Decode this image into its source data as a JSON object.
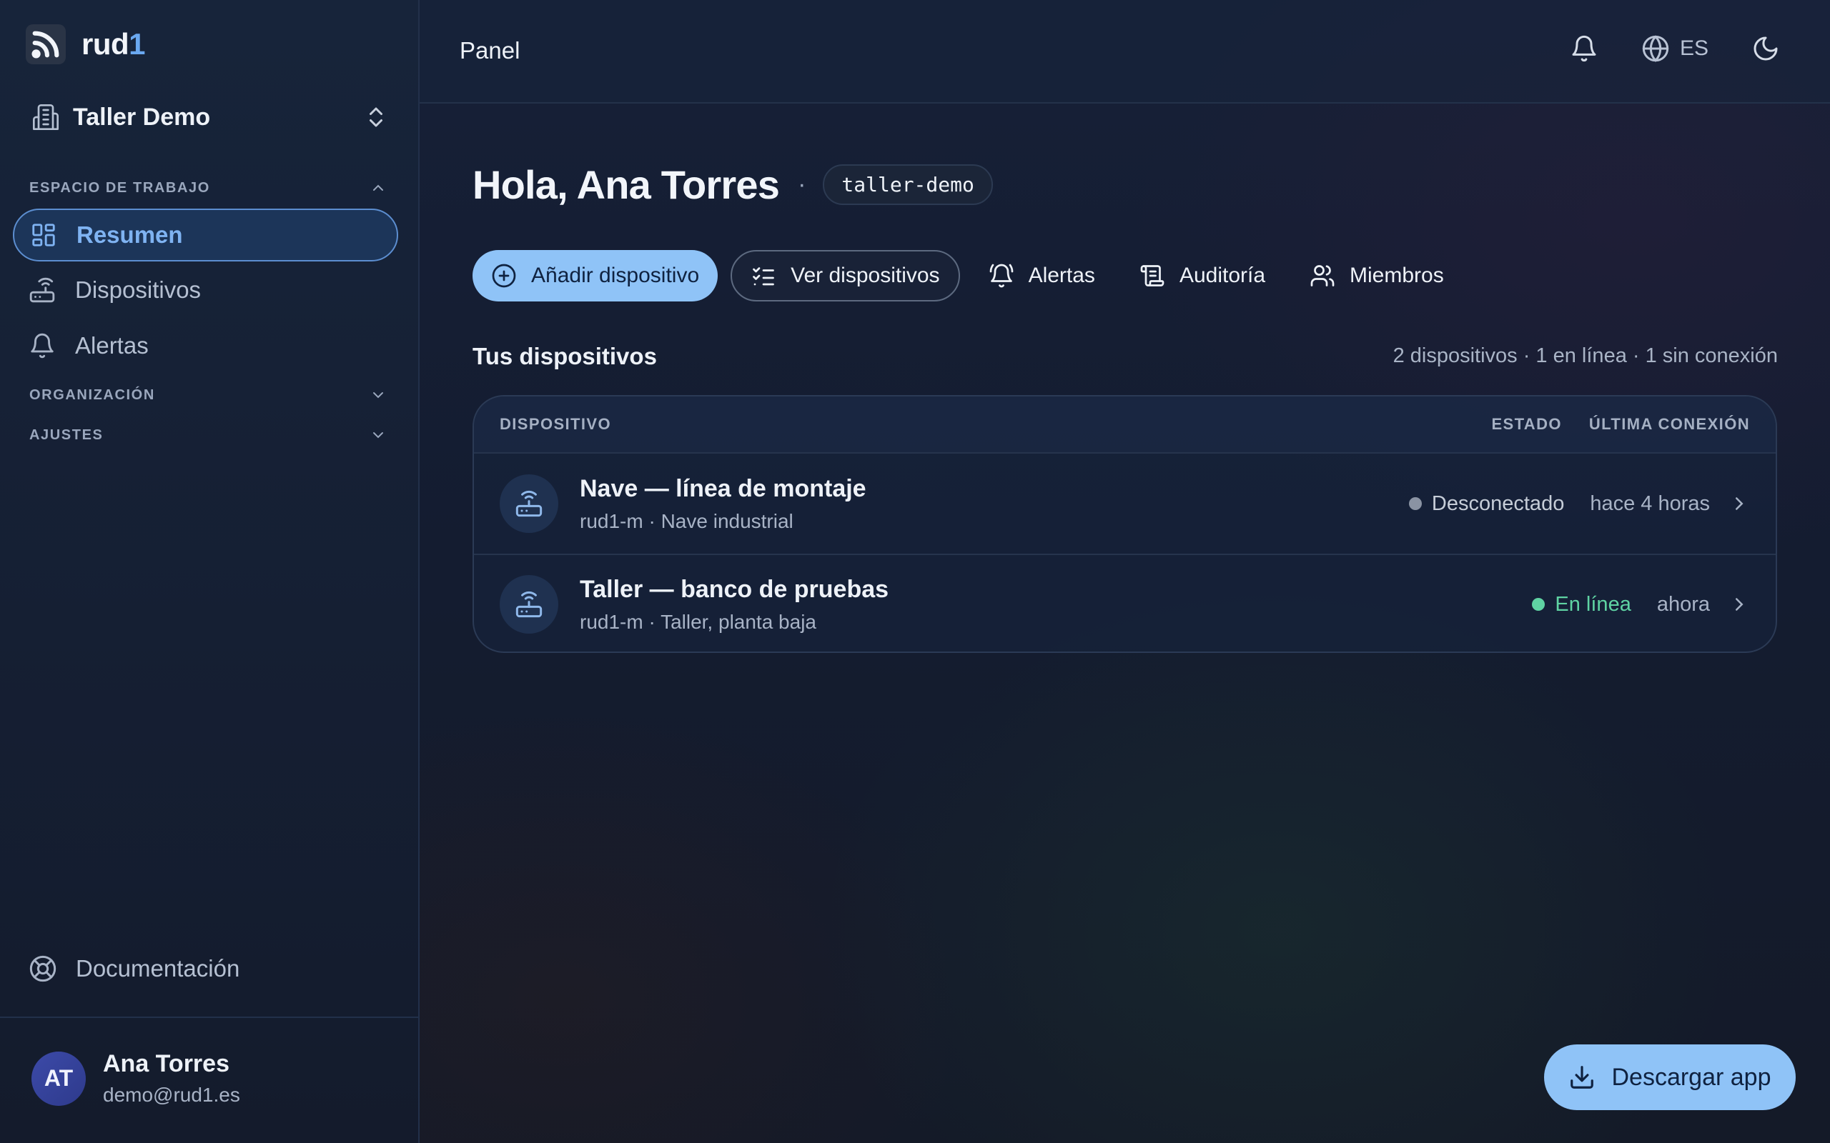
{
  "brand": {
    "name_main": "rud",
    "name_accent": "1"
  },
  "workspace": {
    "name": "Taller Demo"
  },
  "sidebar": {
    "sections": [
      {
        "label": "ESPACIO DE TRABAJO",
        "expanded": true
      },
      {
        "label": "ORGANIZACIÓN",
        "expanded": false
      },
      {
        "label": "AJUSTES",
        "expanded": false
      }
    ],
    "items": [
      {
        "label": "Resumen",
        "icon": "dashboard-icon",
        "active": true
      },
      {
        "label": "Dispositivos",
        "icon": "router-icon",
        "active": false
      },
      {
        "label": "Alertas",
        "icon": "bell-icon",
        "active": false
      }
    ],
    "docs_label": "Documentación"
  },
  "user": {
    "initials": "AT",
    "name": "Ana Torres",
    "email": "demo@rud1.es"
  },
  "topbar": {
    "title": "Panel",
    "lang": "ES"
  },
  "greeting": {
    "title": "Hola, Ana Torres",
    "separator": "·",
    "slug": "taller-demo"
  },
  "actions": [
    {
      "label": "Añadir dispositivo",
      "icon": "plus-circle-icon",
      "style": "primary"
    },
    {
      "label": "Ver dispositivos",
      "icon": "list-check-icon",
      "style": "outline"
    },
    {
      "label": "Alertas",
      "icon": "bell-ring-icon",
      "style": "ghost"
    },
    {
      "label": "Auditoría",
      "icon": "scroll-icon",
      "style": "ghost"
    },
    {
      "label": "Miembros",
      "icon": "users-icon",
      "style": "ghost"
    }
  ],
  "devices": {
    "title": "Tus dispositivos",
    "summary": "2 dispositivos · 1 en línea · 1 sin conexión",
    "columns": {
      "device": "DISPOSITIVO",
      "state": "ESTADO",
      "last": "ÚLTIMA CONEXIÓN"
    },
    "rows": [
      {
        "name": "Nave — línea de montaje",
        "sub": "rud1-m · Nave industrial",
        "status": "Desconectado",
        "status_color": "#8a93a3",
        "last": "hace 4 horas"
      },
      {
        "name": "Taller — banco de pruebas",
        "sub": "rud1-m · Taller, planta baja",
        "status": "En línea",
        "status_color": "#5fd3a3",
        "last": "ahora"
      }
    ]
  },
  "download": {
    "label": "Descargar app"
  },
  "colors": {
    "accent": "#8fc3f7",
    "online": "#5fd3a3",
    "offline": "#8a93a3"
  }
}
